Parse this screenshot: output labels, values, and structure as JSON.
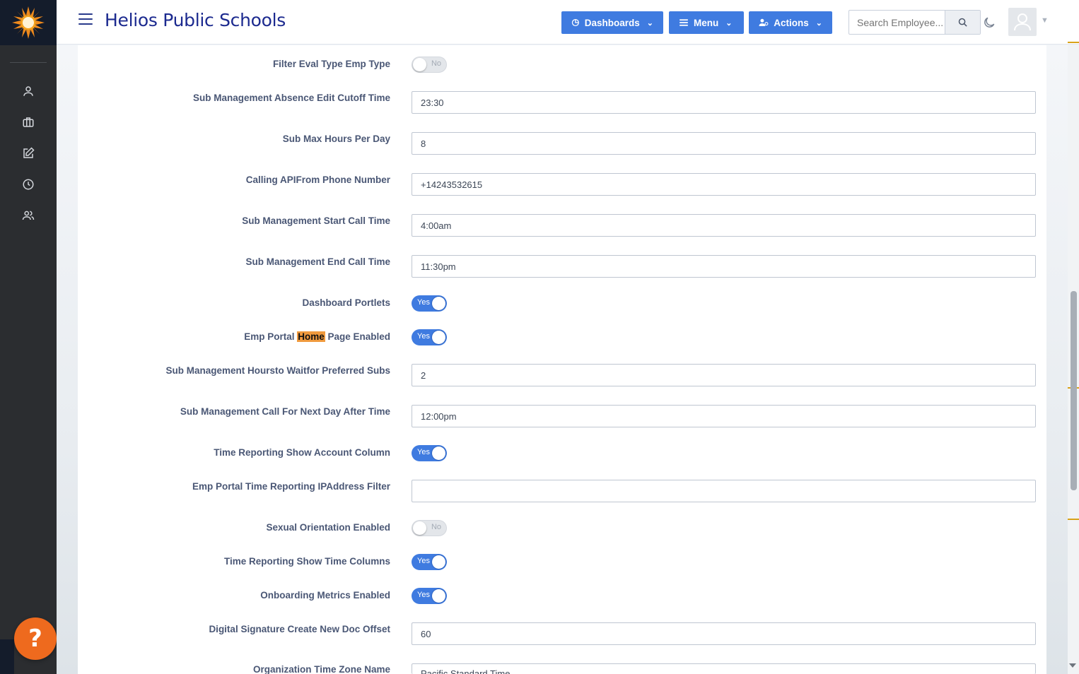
{
  "header": {
    "app_title": "Helios Public Schools",
    "dashboards_label": "Dashboards",
    "menu_label": "Menu",
    "actions_label": "Actions",
    "search_placeholder": "Search Employee..."
  },
  "help_label": "?",
  "settings": [
    {
      "label": "Filter Eval Type Emp Type",
      "type": "toggle",
      "value": "No"
    },
    {
      "label": "Sub Management Absence Edit Cutoff Time",
      "type": "text",
      "value": "23:30"
    },
    {
      "label": "Sub Max Hours Per Day",
      "type": "text",
      "value": "8"
    },
    {
      "label": "Calling APIFrom Phone Number",
      "type": "text",
      "value": "+14243532615"
    },
    {
      "label": "Sub Management Start Call Time",
      "type": "text",
      "value": "4:00am"
    },
    {
      "label": "Sub Management End Call Time",
      "type": "text",
      "value": "11:30pm"
    },
    {
      "label": "Dashboard Portlets",
      "type": "toggle",
      "value": "Yes"
    },
    {
      "label_pre": "Emp Portal ",
      "label_hl": "Home",
      "label_post": " Page Enabled",
      "type": "toggle",
      "value": "Yes"
    },
    {
      "label": "Sub Management Hoursto Waitfor Preferred Subs",
      "type": "text",
      "value": "2"
    },
    {
      "label": "Sub Management Call For Next Day After Time",
      "type": "text",
      "value": "12:00pm"
    },
    {
      "label": "Time Reporting Show Account Column",
      "type": "toggle",
      "value": "Yes"
    },
    {
      "label": "Emp Portal Time Reporting IPAddress Filter",
      "type": "text",
      "value": ""
    },
    {
      "label": "Sexual Orientation Enabled",
      "type": "toggle",
      "value": "No"
    },
    {
      "label": "Time Reporting Show Time Columns",
      "type": "toggle",
      "value": "Yes"
    },
    {
      "label": "Onboarding Metrics Enabled",
      "type": "toggle",
      "value": "Yes"
    },
    {
      "label": "Digital Signature Create New Doc Offset",
      "type": "text",
      "value": "60"
    },
    {
      "label": "Organization Time Zone Name",
      "type": "text",
      "value": "Pacific Standard Time"
    }
  ],
  "colors": {
    "accent": "#3f7be0",
    "sidebar": "#2b2d30",
    "title": "#1c2a8f",
    "help": "#ee6a1e",
    "highlight": "#f09a3e"
  },
  "sidebar_icons": [
    "user-icon",
    "briefcase-icon",
    "edit-icon",
    "clock-icon",
    "users-icon"
  ]
}
